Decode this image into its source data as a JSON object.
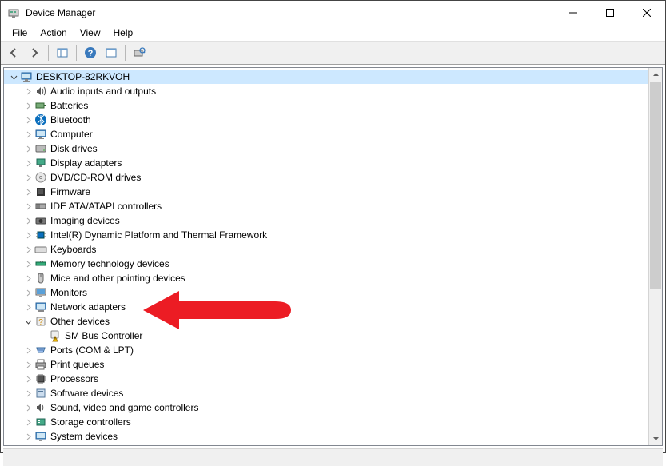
{
  "window": {
    "title": "Device Manager"
  },
  "menubar": {
    "items": [
      "File",
      "Action",
      "View",
      "Help"
    ]
  },
  "toolbar": {
    "buttons": [
      {
        "id": "back",
        "name": "back-button"
      },
      {
        "id": "forward",
        "name": "forward-button"
      },
      {
        "sep": true
      },
      {
        "id": "show-hide-tree",
        "name": "show-hide-tree-button"
      },
      {
        "sep": true
      },
      {
        "id": "help",
        "name": "help-button"
      },
      {
        "id": "properties",
        "name": "properties-button"
      },
      {
        "sep": true
      },
      {
        "id": "scan",
        "name": "scan-hardware-button"
      }
    ]
  },
  "tree": {
    "root": {
      "label": "DESKTOP-82RKVOH",
      "expanded": true,
      "selected": true,
      "icon": "computer-icon"
    },
    "categories": [
      {
        "label": "Audio inputs and outputs",
        "icon": "audio-icon",
        "expanded": false
      },
      {
        "label": "Batteries",
        "icon": "battery-icon",
        "expanded": false
      },
      {
        "label": "Bluetooth",
        "icon": "bluetooth-icon",
        "expanded": false
      },
      {
        "label": "Computer",
        "icon": "computer-icon",
        "expanded": false
      },
      {
        "label": "Disk drives",
        "icon": "disk-icon",
        "expanded": false
      },
      {
        "label": "Display adapters",
        "icon": "display-icon",
        "expanded": false
      },
      {
        "label": "DVD/CD-ROM drives",
        "icon": "dvd-icon",
        "expanded": false
      },
      {
        "label": "Firmware",
        "icon": "firmware-icon",
        "expanded": false
      },
      {
        "label": "IDE ATA/ATAPI controllers",
        "icon": "ide-icon",
        "expanded": false
      },
      {
        "label": "Imaging devices",
        "icon": "imaging-icon",
        "expanded": false
      },
      {
        "label": "Intel(R) Dynamic Platform and Thermal Framework",
        "icon": "intel-icon",
        "expanded": false
      },
      {
        "label": "Keyboards",
        "icon": "keyboard-icon",
        "expanded": false
      },
      {
        "label": "Memory technology devices",
        "icon": "memory-icon",
        "expanded": false
      },
      {
        "label": "Mice and other pointing devices",
        "icon": "mouse-icon",
        "expanded": false
      },
      {
        "label": "Monitors",
        "icon": "monitor-icon",
        "expanded": false
      },
      {
        "label": "Network adapters",
        "icon": "network-icon",
        "expanded": false
      },
      {
        "label": "Other devices",
        "icon": "other-icon",
        "expanded": true,
        "children": [
          {
            "label": "SM Bus Controller",
            "icon": "warning-device-icon"
          }
        ]
      },
      {
        "label": "Ports (COM & LPT)",
        "icon": "ports-icon",
        "expanded": false
      },
      {
        "label": "Print queues",
        "icon": "printer-icon",
        "expanded": false
      },
      {
        "label": "Processors",
        "icon": "processor-icon",
        "expanded": false
      },
      {
        "label": "Software devices",
        "icon": "software-icon",
        "expanded": false
      },
      {
        "label": "Sound, video and game controllers",
        "icon": "sound-icon",
        "expanded": false
      },
      {
        "label": "Storage controllers",
        "icon": "storage-icon",
        "expanded": false
      },
      {
        "label": "System devices",
        "icon": "system-icon",
        "expanded": false
      }
    ]
  },
  "annotation": {
    "arrow_target": "Network adapters"
  }
}
